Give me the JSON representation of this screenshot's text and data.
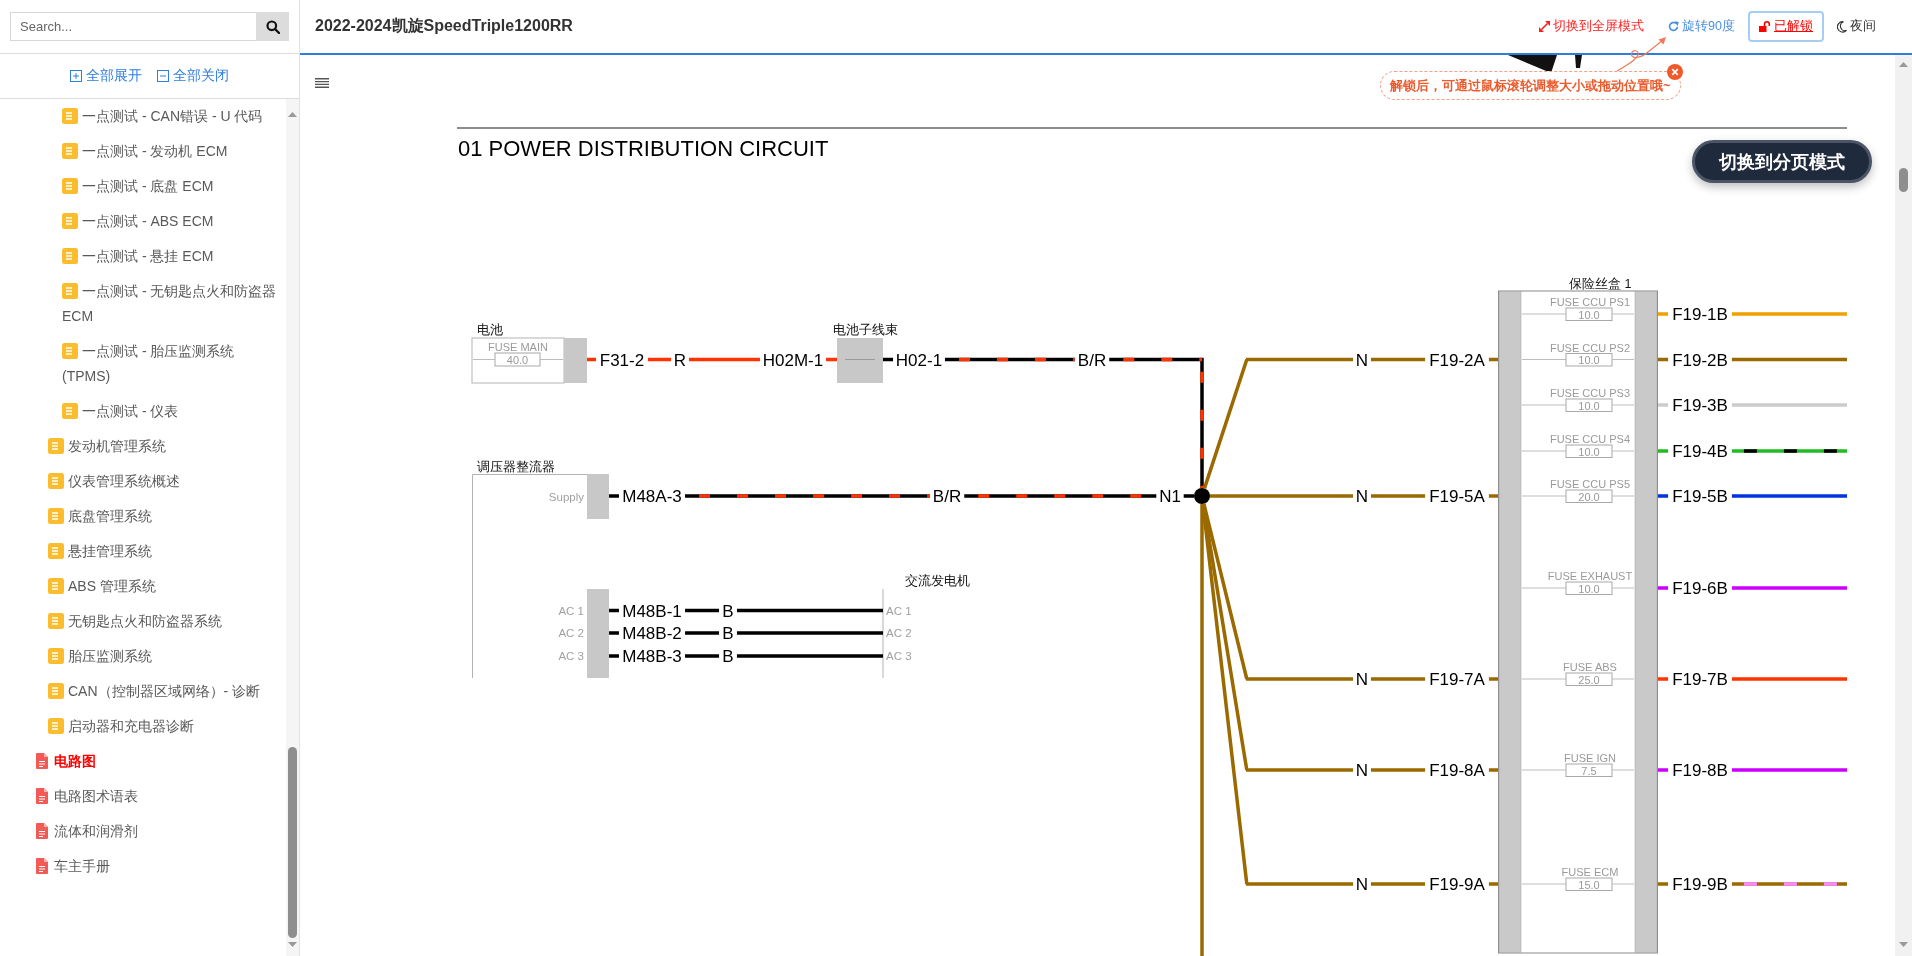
{
  "sidebar": {
    "search": {
      "placeholder": "Search..."
    },
    "expand_all": "全部展开",
    "collapse_all": "全部关闭",
    "tree": [
      {
        "children": [
          {
            "children": [
              {
                "label": "一点测试 - CAN错误 - U 代码",
                "selected": false
              },
              {
                "label": "一点测试 - 发动机 ECM",
                "selected": false
              },
              {
                "label": "一点测试 - 底盘 ECM",
                "selected": false
              },
              {
                "label": "一点测试 - ABS ECM",
                "selected": false
              },
              {
                "label": "一点测试 - 悬挂 ECM",
                "selected": false
              },
              {
                "label": "一点测试 - 无钥匙点火和防盗器 ECM",
                "selected": false
              },
              {
                "label": "一点测试 - 胎压监测系统 (TPMS)",
                "selected": false
              },
              {
                "label": "一点测试 - 仪表",
                "selected": false
              }
            ]
          },
          {
            "label": "发动机管理系统",
            "selected": false
          },
          {
            "label": "仪表管理系统概述",
            "selected": false
          },
          {
            "label": "底盘管理系统",
            "selected": false
          },
          {
            "label": "悬挂管理系统",
            "selected": false
          },
          {
            "label": "ABS 管理系统",
            "selected": false
          },
          {
            "label": "无钥匙点火和防盗器系统",
            "selected": false
          },
          {
            "label": "胎压监测系统",
            "selected": false
          },
          {
            "label": "CAN（控制器区域网络）- 诊断",
            "selected": false
          },
          {
            "label": "启动器和充电器诊断",
            "selected": false
          }
        ]
      },
      {
        "label": "电路图",
        "selected": true
      },
      {
        "label": "电路图术语表",
        "selected": false
      },
      {
        "label": "流体和润滑剂",
        "selected": false
      },
      {
        "label": "车主手册",
        "selected": false
      }
    ]
  },
  "header": {
    "title": "2022-2024凯旋SpeedTriple1200RR",
    "actions": [
      {
        "kind": "fullscreen",
        "label": "切换到全屏模式"
      },
      {
        "kind": "rotate",
        "label": "旋转90度"
      },
      {
        "kind": "lock",
        "label": "已解锁"
      },
      {
        "kind": "night",
        "label": "夜间"
      }
    ]
  },
  "hint": {
    "text": "解锁后，可通过鼠标滚轮调整大小或拖动位置哦~"
  },
  "page_mode_button": "切换到分页模式",
  "diagram": {
    "title": "01 POWER DISTRIBUTION CIRCUIT",
    "battery": {
      "label": "电池",
      "fuse": "FUSE MAIN",
      "rating": "40.0"
    },
    "harness": {
      "label": "电池子线束"
    },
    "regulator": {
      "label": "调压器整流器",
      "pins": [
        "Supply",
        "AC 1",
        "AC 2",
        "AC 3"
      ]
    },
    "alternator": {
      "label": "交流发电机",
      "pins": [
        "AC 1",
        "AC 2",
        "AC 3"
      ]
    },
    "wires": [
      {
        "labels": [
          "F31-2",
          "R",
          "H02M-1"
        ],
        "color": "#ff3300"
      },
      {
        "labels": [
          "H02-1",
          "B/R"
        ],
        "color": "#000000",
        "stripe": {
          "color": "#ff3300"
        }
      },
      {
        "labels": [
          "M48A-3",
          "B/R",
          "N1"
        ],
        "color": "#000000",
        "stripe": {
          "color": "#ff3300"
        }
      },
      {
        "labels": [
          "M48B-1",
          "B"
        ],
        "color": "#000000"
      },
      {
        "labels": [
          "M48B-2",
          "B"
        ],
        "color": "#000000"
      },
      {
        "labels": [
          "M48B-3",
          "B"
        ],
        "color": "#000000"
      }
    ],
    "fuse_box": {
      "label": "保险丝盒 1",
      "fuses": [
        {
          "name": "FUSE CCU PS1",
          "rating": "10.0",
          "output": {
            "pin": "F19-1B",
            "color": "#f0a000"
          }
        },
        {
          "name": "FUSE CCU PS2",
          "rating": "10.0",
          "input": {
            "code": "N",
            "pin": "F19-2A"
          },
          "output": {
            "pin": "F19-2B",
            "color": "#9a6a00"
          }
        },
        {
          "name": "FUSE CCU PS3",
          "rating": "10.0",
          "output": {
            "pin": "F19-3B",
            "color": "#cccccc"
          }
        },
        {
          "name": "FUSE CCU PS4",
          "rating": "10.0",
          "output": {
            "pin": "F19-4B",
            "color": "#22bb22",
            "stripe": {
              "color": "#000000"
            }
          }
        },
        {
          "name": "FUSE CCU PS5",
          "rating": "20.0",
          "input": {
            "code": "N",
            "pin": "F19-5A"
          },
          "output": {
            "pin": "F19-5B",
            "color": "#0033dd"
          }
        },
        {
          "name": "FUSE EXHAUST",
          "rating": "10.0",
          "output": {
            "pin": "F19-6B",
            "color": "#cc00ff"
          }
        },
        {
          "name": "FUSE ABS",
          "rating": "25.0",
          "input": {
            "code": "N",
            "pin": "F19-7A"
          },
          "output": {
            "pin": "F19-7B",
            "color": "#ff3300"
          }
        },
        {
          "name": "FUSE IGN",
          "rating": "7.5",
          "input": {
            "code": "N",
            "pin": "F19-8A"
          },
          "output": {
            "pin": "F19-8B",
            "color": "#cc00ff"
          }
        },
        {
          "name": "FUSE ECM",
          "rating": "15.0",
          "input": {
            "code": "N",
            "pin": "F19-9A"
          },
          "output": {
            "pin": "F19-9B",
            "color": "#9a6a00",
            "stripe": {
              "color": "#ff88ff"
            }
          }
        }
      ]
    }
  }
}
